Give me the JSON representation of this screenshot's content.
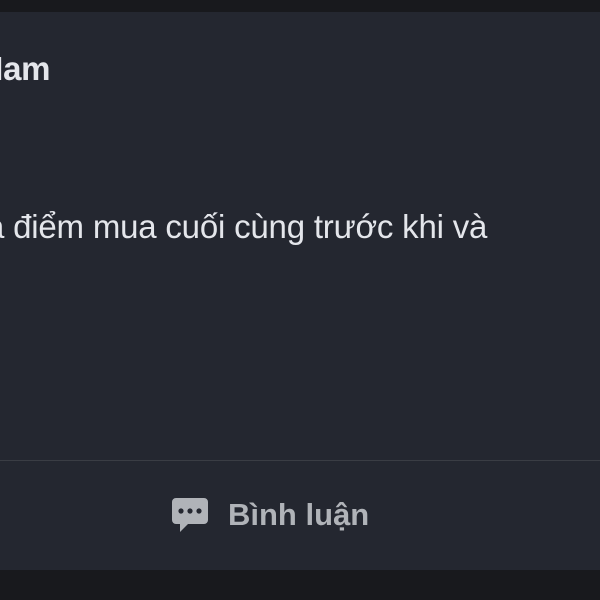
{
  "post": {
    "author_fragment": "t Nam",
    "body_fragment": "a điểm mua cuối cùng trước khi và"
  },
  "actions": {
    "comment_label": "Bình luận",
    "comment_icon": "comment-icon"
  },
  "colors": {
    "page_background": "#18191d",
    "card_background": "#242730",
    "primary_text": "#e4e6eb",
    "secondary_text": "#b0b3b8",
    "divider": "#3a3d44"
  }
}
